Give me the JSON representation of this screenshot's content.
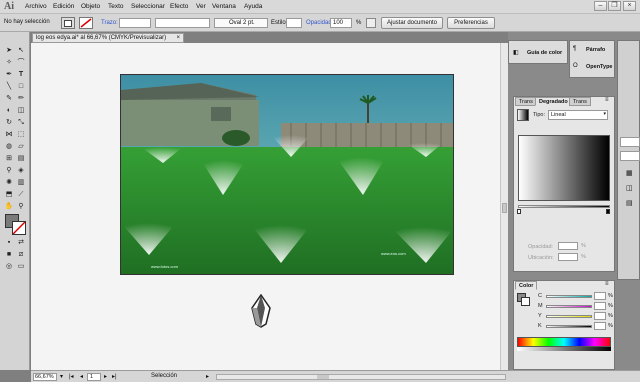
{
  "app": {
    "logo": "Ai"
  },
  "menu": [
    "Archivo",
    "Edición",
    "Objeto",
    "Texto",
    "Seleccionar",
    "Efecto",
    "Ver",
    "Ventana",
    "Ayuda"
  ],
  "control": {
    "selection": "No hay selección",
    "stroke_label": "Trazo:",
    "brush": "Oval 2 pt.",
    "style_label": "Estilo:",
    "opacity_label": "Opacidad:",
    "opacity": "100",
    "percent": "%",
    "doc_setup": "Ajustar documento",
    "prefs": "Preferencias"
  },
  "doc": {
    "tab": "log eos edya.ai* al 66,67% (CMYK/Previsualizar)"
  },
  "artwork": {
    "credit_left": "www.fotos.com",
    "credit_right": "www.eos.com"
  },
  "status": {
    "zoom": "66,67%",
    "page": "1",
    "tool": "Selección"
  },
  "panels": {
    "guide_tab": "Guía de color",
    "paragraph_tab": "Párrafo",
    "opentype_tab": "OpenType",
    "gradient": {
      "tabs": [
        "Trans",
        "Degradado",
        "Trans"
      ],
      "type_label": "Tipo:",
      "type_value": "Lineal",
      "opacity_label": "Opacidad:",
      "location_label": "Ubicación:",
      "percent": "%"
    },
    "color": {
      "title": "Color",
      "channels": [
        "C",
        "M",
        "Y",
        "K"
      ],
      "percent": "%"
    }
  },
  "colors": {
    "grass": "#2e8b2e",
    "sky": "#3d8a9a",
    "accent": "#4444cc"
  }
}
